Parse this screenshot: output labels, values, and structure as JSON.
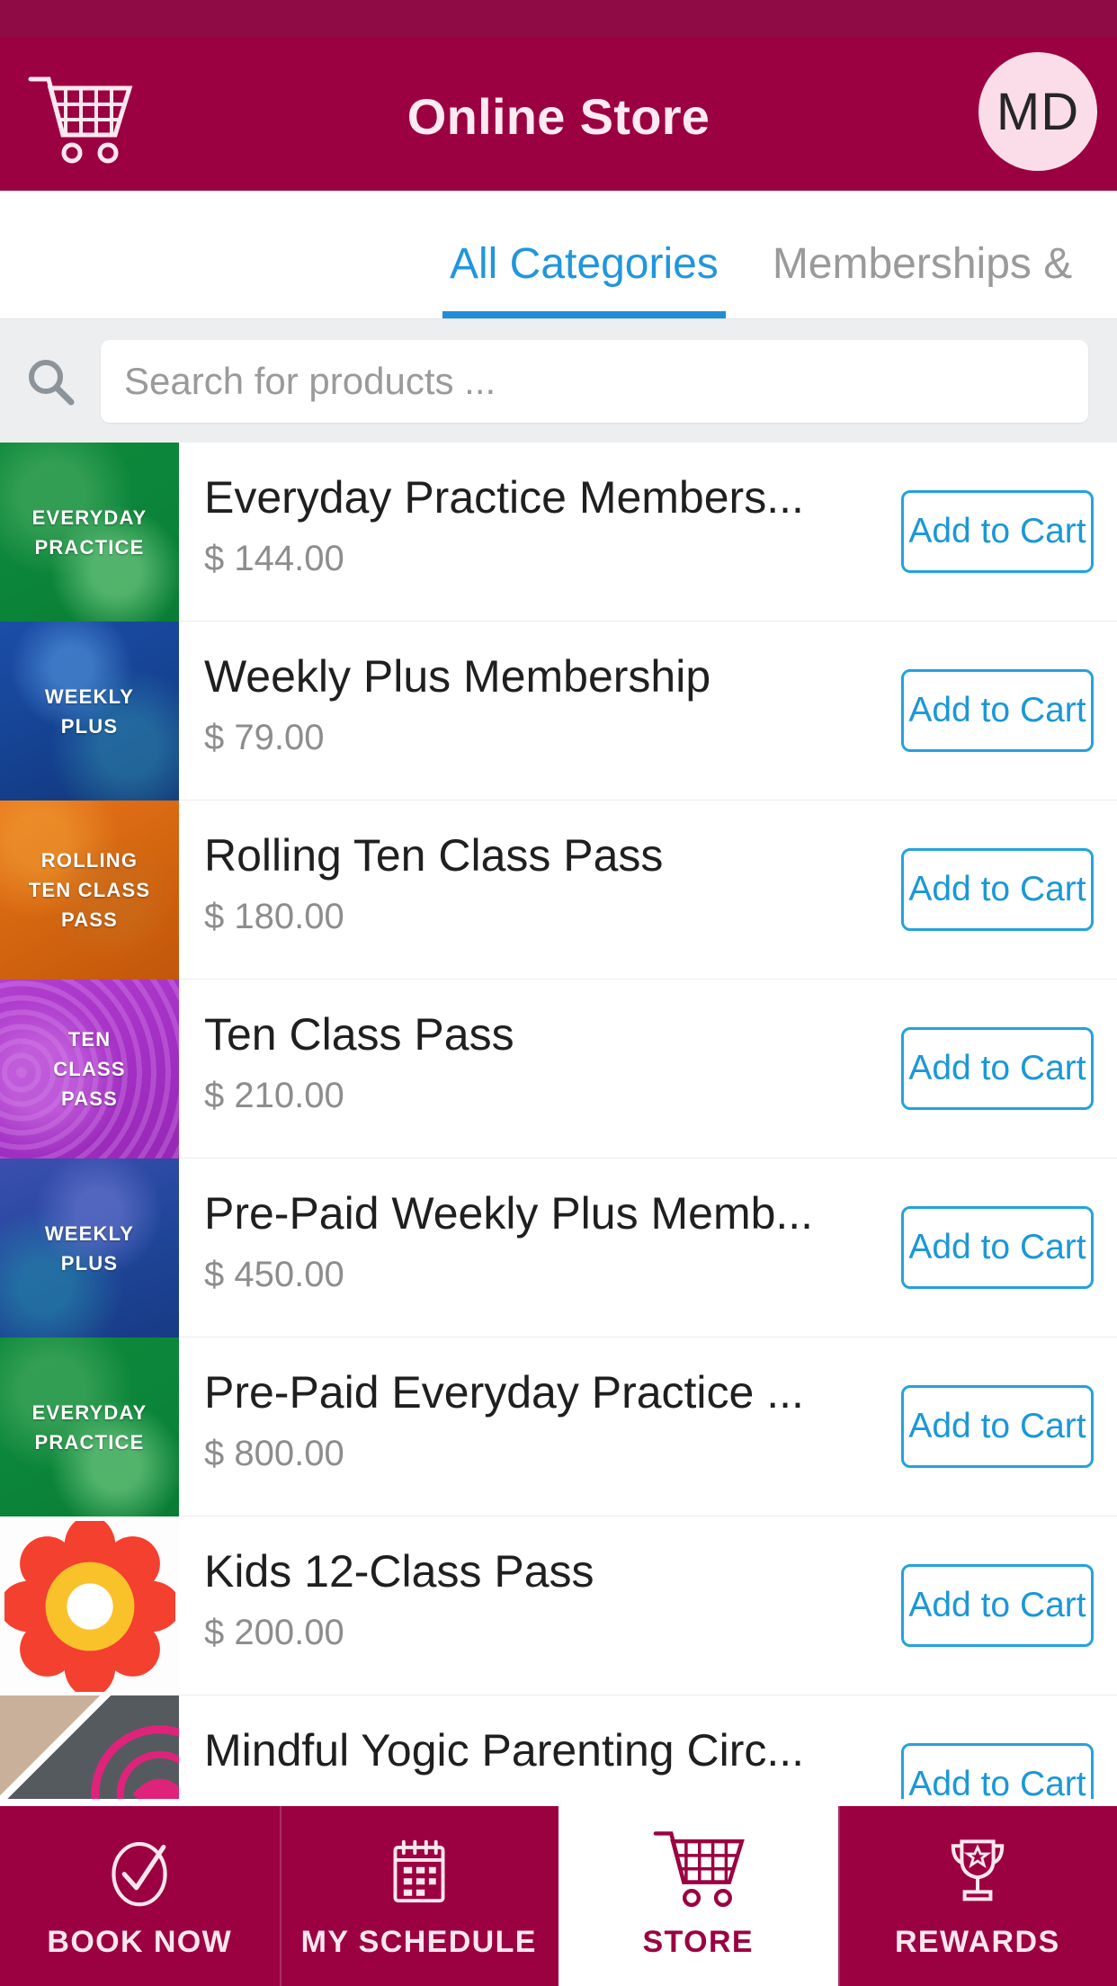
{
  "header": {
    "title": "Online Store",
    "cart_icon": "shopping-cart-icon",
    "avatar_initials": "MD",
    "brand_color": "#9b0041",
    "avatar_bg": "#fbdde9"
  },
  "tabs": {
    "accent_color": "#1f8ed6",
    "items": [
      {
        "label": "All Categories",
        "active": true
      },
      {
        "label": "Memberships &",
        "active": false
      }
    ]
  },
  "search": {
    "placeholder": "Search for products ...",
    "value": "",
    "icon": "search-icon"
  },
  "products": [
    {
      "name": "Everyday Practice Members...",
      "price": "$ 144.00",
      "thumb_label": "EVERYDAY\nPRACTICE",
      "thumb_style": "green",
      "button": "Add to Cart"
    },
    {
      "name": "Weekly Plus Membership",
      "price": "$ 79.00",
      "thumb_label": "WEEKLY\nPLUS",
      "thumb_style": "blue",
      "button": "Add to Cart"
    },
    {
      "name": "Rolling Ten Class Pass",
      "price": "$ 180.00",
      "thumb_label": "ROLLING\nTEN CLASS\nPASS",
      "thumb_style": "orange",
      "button": "Add to Cart"
    },
    {
      "name": "Ten Class Pass",
      "price": "$ 210.00",
      "thumb_label": "TEN\nCLASS\nPASS",
      "thumb_style": "purple",
      "button": "Add to Cart"
    },
    {
      "name": "Pre-Paid Weekly Plus Memb...",
      "price": "$ 450.00",
      "thumb_label": "WEEKLY\nPLUS",
      "thumb_style": "blue2",
      "button": "Add to Cart"
    },
    {
      "name": "Pre-Paid Everyday Practice ...",
      "price": "$ 800.00",
      "thumb_label": "EVERYDAY\nPRACTICE",
      "thumb_style": "green",
      "button": "Add to Cart"
    },
    {
      "name": "Kids 12-Class Pass",
      "price": "$ 200.00",
      "thumb_label": "",
      "thumb_style": "flower",
      "button": "Add to Cart"
    },
    {
      "name": "Mindful Yogic Parenting Circ...",
      "price": "",
      "thumb_label": "",
      "thumb_style": "split",
      "button": "Add to Cart"
    }
  ],
  "bottom_nav": {
    "items": [
      {
        "label": "BOOK NOW",
        "icon": "check-circle-icon",
        "active": false
      },
      {
        "label": "MY SCHEDULE",
        "icon": "calendar-icon",
        "active": false
      },
      {
        "label": "STORE",
        "icon": "shopping-cart-icon",
        "active": true
      },
      {
        "label": "REWARDS",
        "icon": "trophy-icon",
        "active": false
      }
    ]
  }
}
